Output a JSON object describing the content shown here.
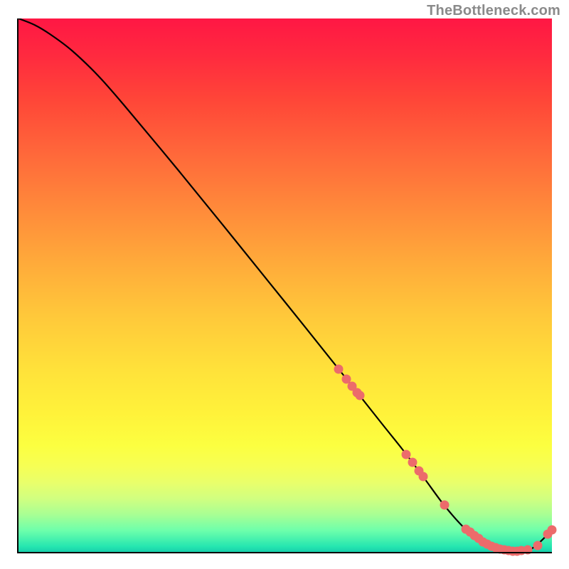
{
  "attribution": "TheBottleneck.com",
  "colors": {
    "gradient_top": "#ff1744",
    "gradient_bottom": "#18cfac",
    "curve": "#000000",
    "dots": "#ec6b6b",
    "axis": "#000000"
  },
  "chart_data": {
    "type": "line",
    "title": "",
    "xlabel": "",
    "ylabel": "",
    "xlim": [
      0,
      100
    ],
    "ylim": [
      0,
      100
    ],
    "curve": {
      "x": [
        0,
        3,
        6,
        10,
        15,
        20,
        30,
        40,
        50,
        60,
        68,
        72,
        76,
        80,
        84,
        88,
        92,
        96,
        100
      ],
      "y": [
        100,
        98.8,
        97.0,
        94.0,
        89.2,
        83.5,
        71.5,
        59.2,
        46.8,
        34.3,
        24.2,
        19.2,
        13.9,
        8.5,
        4.1,
        1.3,
        0.2,
        0.5,
        4.1
      ]
    },
    "dots": [
      {
        "x": 60.0,
        "y": 34.3
      },
      {
        "x": 61.5,
        "y": 32.4
      },
      {
        "x": 62.5,
        "y": 31.1
      },
      {
        "x": 63.5,
        "y": 29.9
      },
      {
        "x": 64.0,
        "y": 29.3
      },
      {
        "x": 72.7,
        "y": 18.3
      },
      {
        "x": 73.8,
        "y": 16.8
      },
      {
        "x": 75.0,
        "y": 15.2
      },
      {
        "x": 75.8,
        "y": 14.2
      },
      {
        "x": 79.8,
        "y": 8.8
      },
      {
        "x": 83.8,
        "y": 4.3
      },
      {
        "x": 84.6,
        "y": 3.7
      },
      {
        "x": 85.4,
        "y": 3.1
      },
      {
        "x": 86.2,
        "y": 2.5
      },
      {
        "x": 87.0,
        "y": 1.9
      },
      {
        "x": 87.8,
        "y": 1.5
      },
      {
        "x": 88.6,
        "y": 1.1
      },
      {
        "x": 89.4,
        "y": 0.8
      },
      {
        "x": 90.2,
        "y": 0.5
      },
      {
        "x": 91.0,
        "y": 0.35
      },
      {
        "x": 91.8,
        "y": 0.25
      },
      {
        "x": 92.6,
        "y": 0.2
      },
      {
        "x": 93.4,
        "y": 0.2
      },
      {
        "x": 94.2,
        "y": 0.25
      },
      {
        "x": 95.5,
        "y": 0.4
      },
      {
        "x": 97.3,
        "y": 1.15
      },
      {
        "x": 99.2,
        "y": 3.3
      },
      {
        "x": 100.0,
        "y": 4.1
      }
    ]
  }
}
